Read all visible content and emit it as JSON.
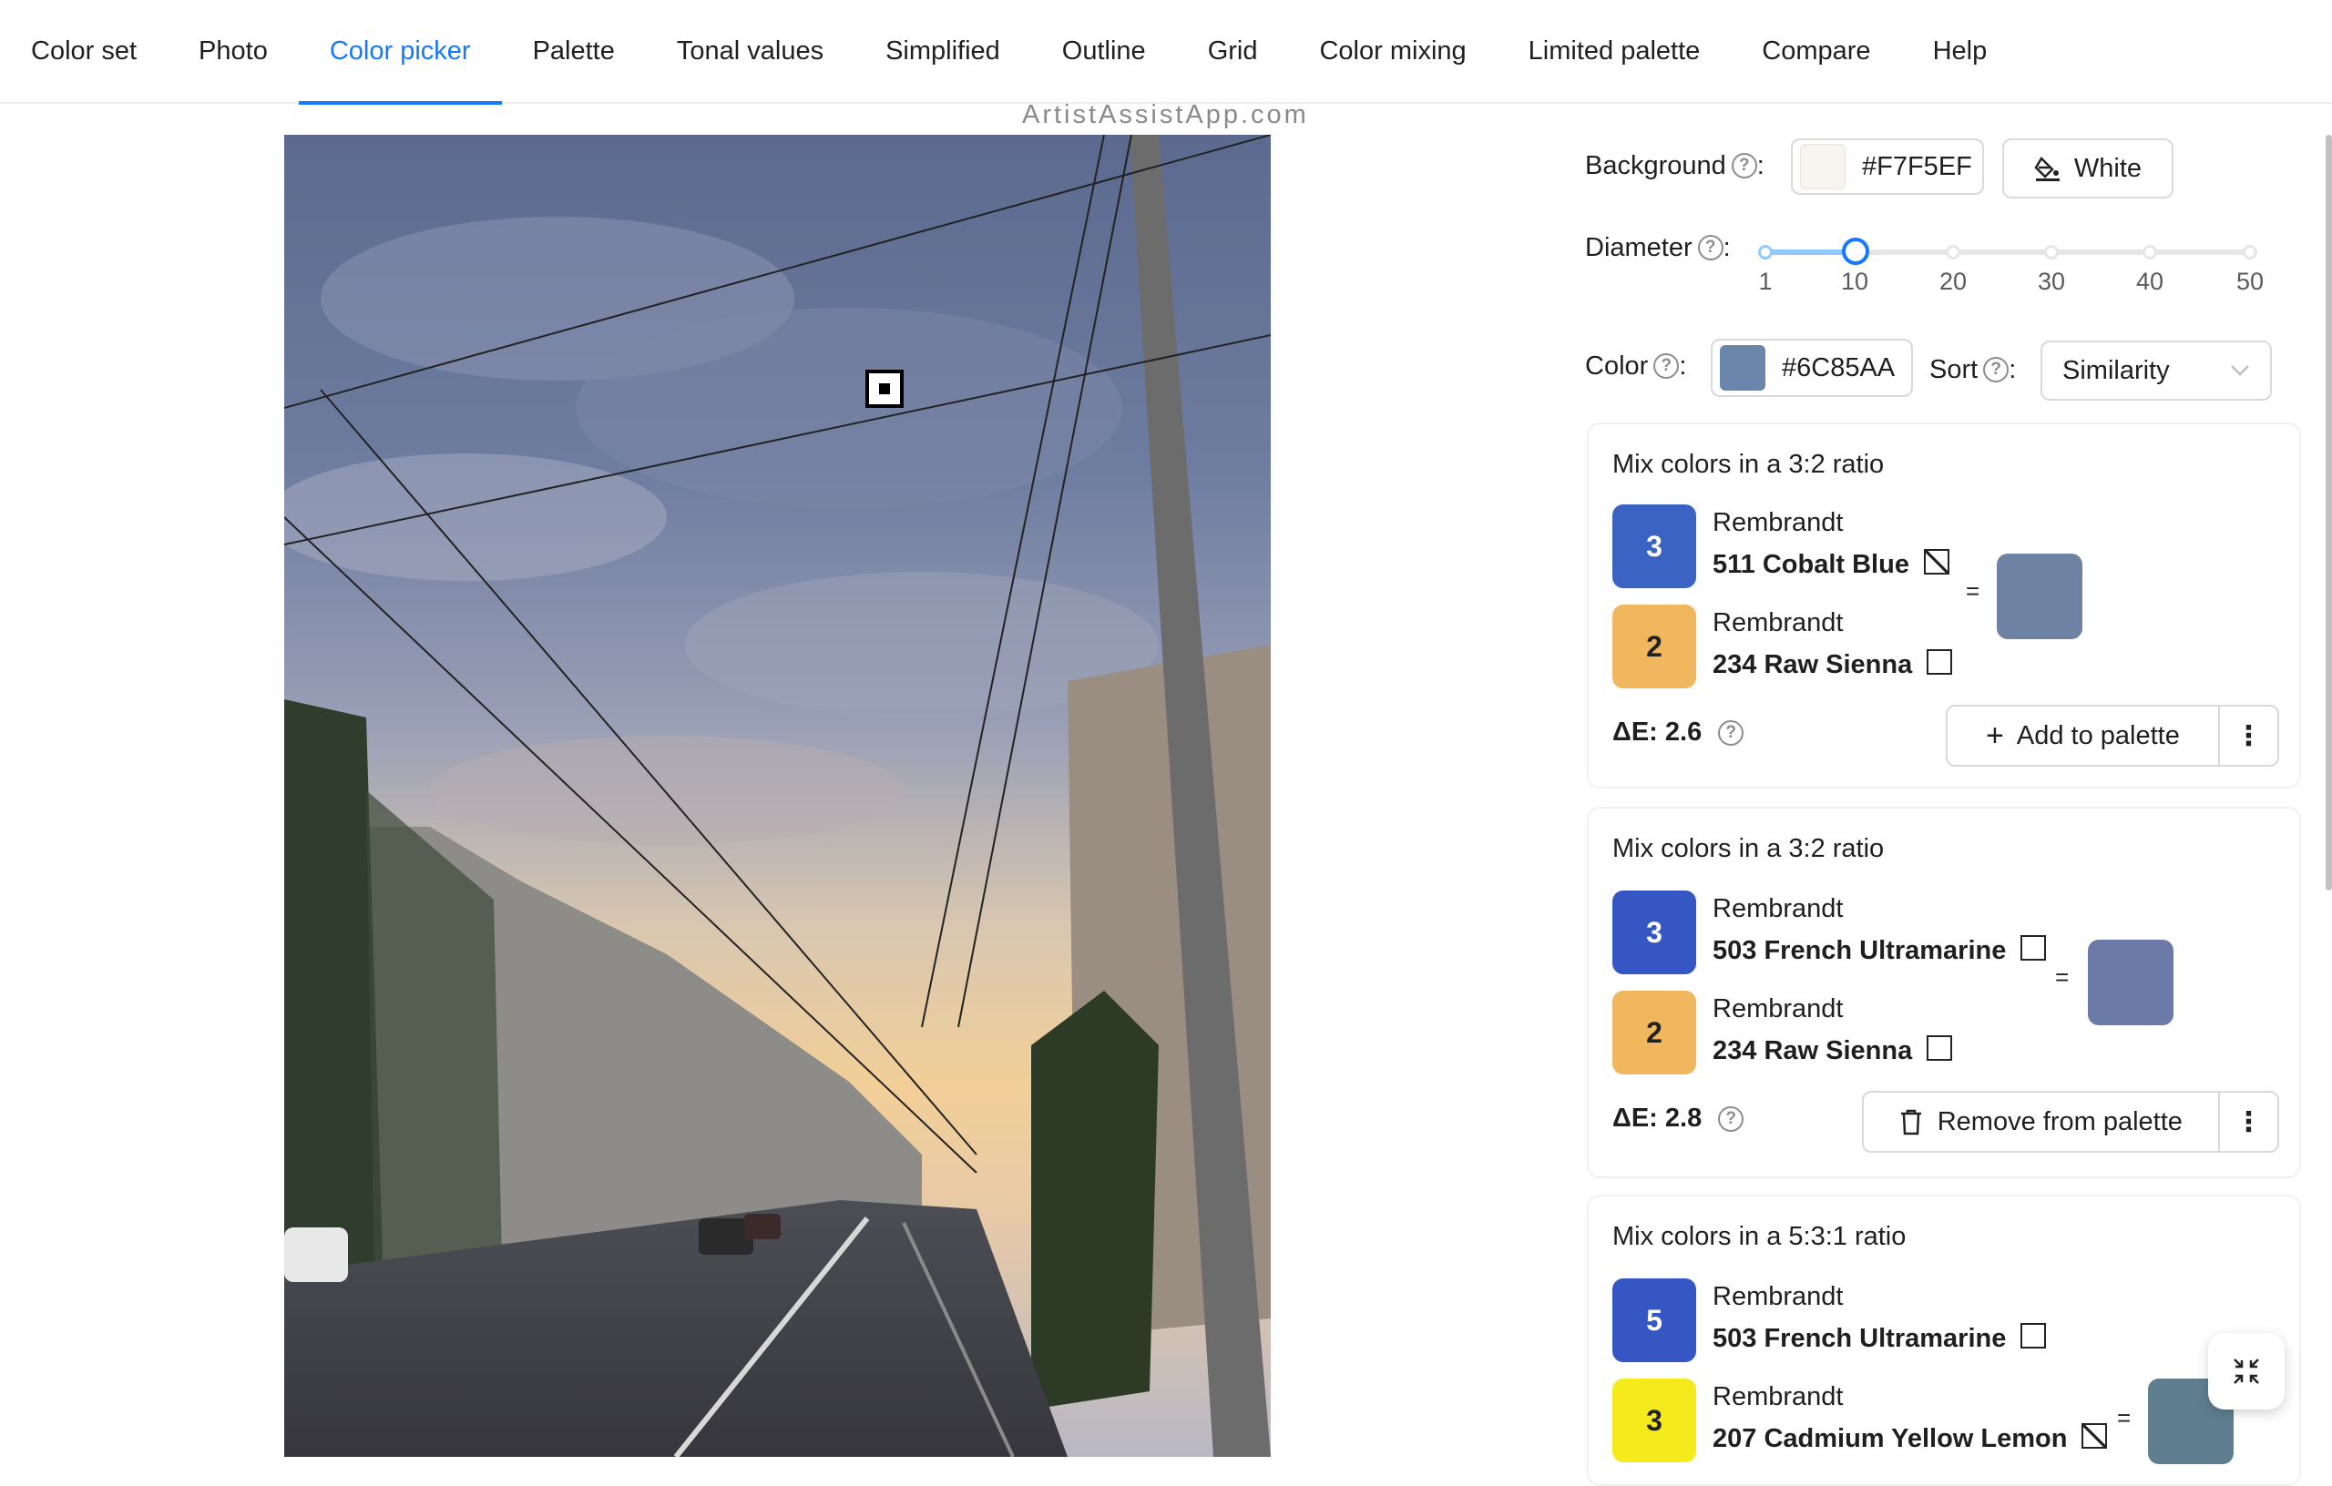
{
  "tabs": [
    "Color set",
    "Photo",
    "Color picker",
    "Palette",
    "Tonal values",
    "Simplified",
    "Outline",
    "Grid",
    "Color mixing",
    "Limited palette",
    "Compare",
    "Help"
  ],
  "active_tab": "Color picker",
  "watermark": "ArtistAssistApp.com",
  "controls": {
    "background_label": "Background",
    "background_value": "#F7F5EF",
    "white_button": "White",
    "diameter_label": "Diameter",
    "diameter_value": 10,
    "diameter_marks": [
      "1",
      "10",
      "20",
      "30",
      "40",
      "50"
    ],
    "color_label": "Color",
    "color_value": "#6C85AA",
    "sort_label": "Sort",
    "sort_value": "Similarity"
  },
  "mixes": [
    {
      "title": "Mix colors in a 3:2 ratio",
      "paints": [
        {
          "parts": "3",
          "brand": "Rembrandt",
          "name": "511 Cobalt Blue",
          "color": "#3a63c4",
          "checkbox": "diagonal"
        },
        {
          "parts": "2",
          "brand": "Rembrandt",
          "name": "234 Raw Sienna",
          "color": "#f0b75e",
          "checkbox": "empty"
        }
      ],
      "result_color": "#6e83a3",
      "delta_e": "ΔE: 2.6",
      "action": "Add to palette",
      "action_icon": "plus-icon"
    },
    {
      "title": "Mix colors in a 3:2 ratio",
      "paints": [
        {
          "parts": "3",
          "brand": "Rembrandt",
          "name": "503 French Ultramarine",
          "color": "#3656c4",
          "checkbox": "empty"
        },
        {
          "parts": "2",
          "brand": "Rembrandt",
          "name": "234 Raw Sienna",
          "color": "#f0b75e",
          "checkbox": "empty"
        }
      ],
      "result_color": "#6b7aa6",
      "delta_e": "ΔE: 2.8",
      "action": "Remove from palette",
      "action_icon": "trash-icon"
    },
    {
      "title": "Mix colors in a 5:3:1 ratio",
      "paints": [
        {
          "parts": "5",
          "brand": "Rembrandt",
          "name": "503 French Ultramarine",
          "color": "#3656c4",
          "checkbox": "empty"
        },
        {
          "parts": "3",
          "brand": "Rembrandt",
          "name": "207 Cadmium Yellow Lemon",
          "color": "#f5ea1c",
          "checkbox": "diagonal"
        }
      ],
      "result_color": "#5f7f91"
    }
  ]
}
